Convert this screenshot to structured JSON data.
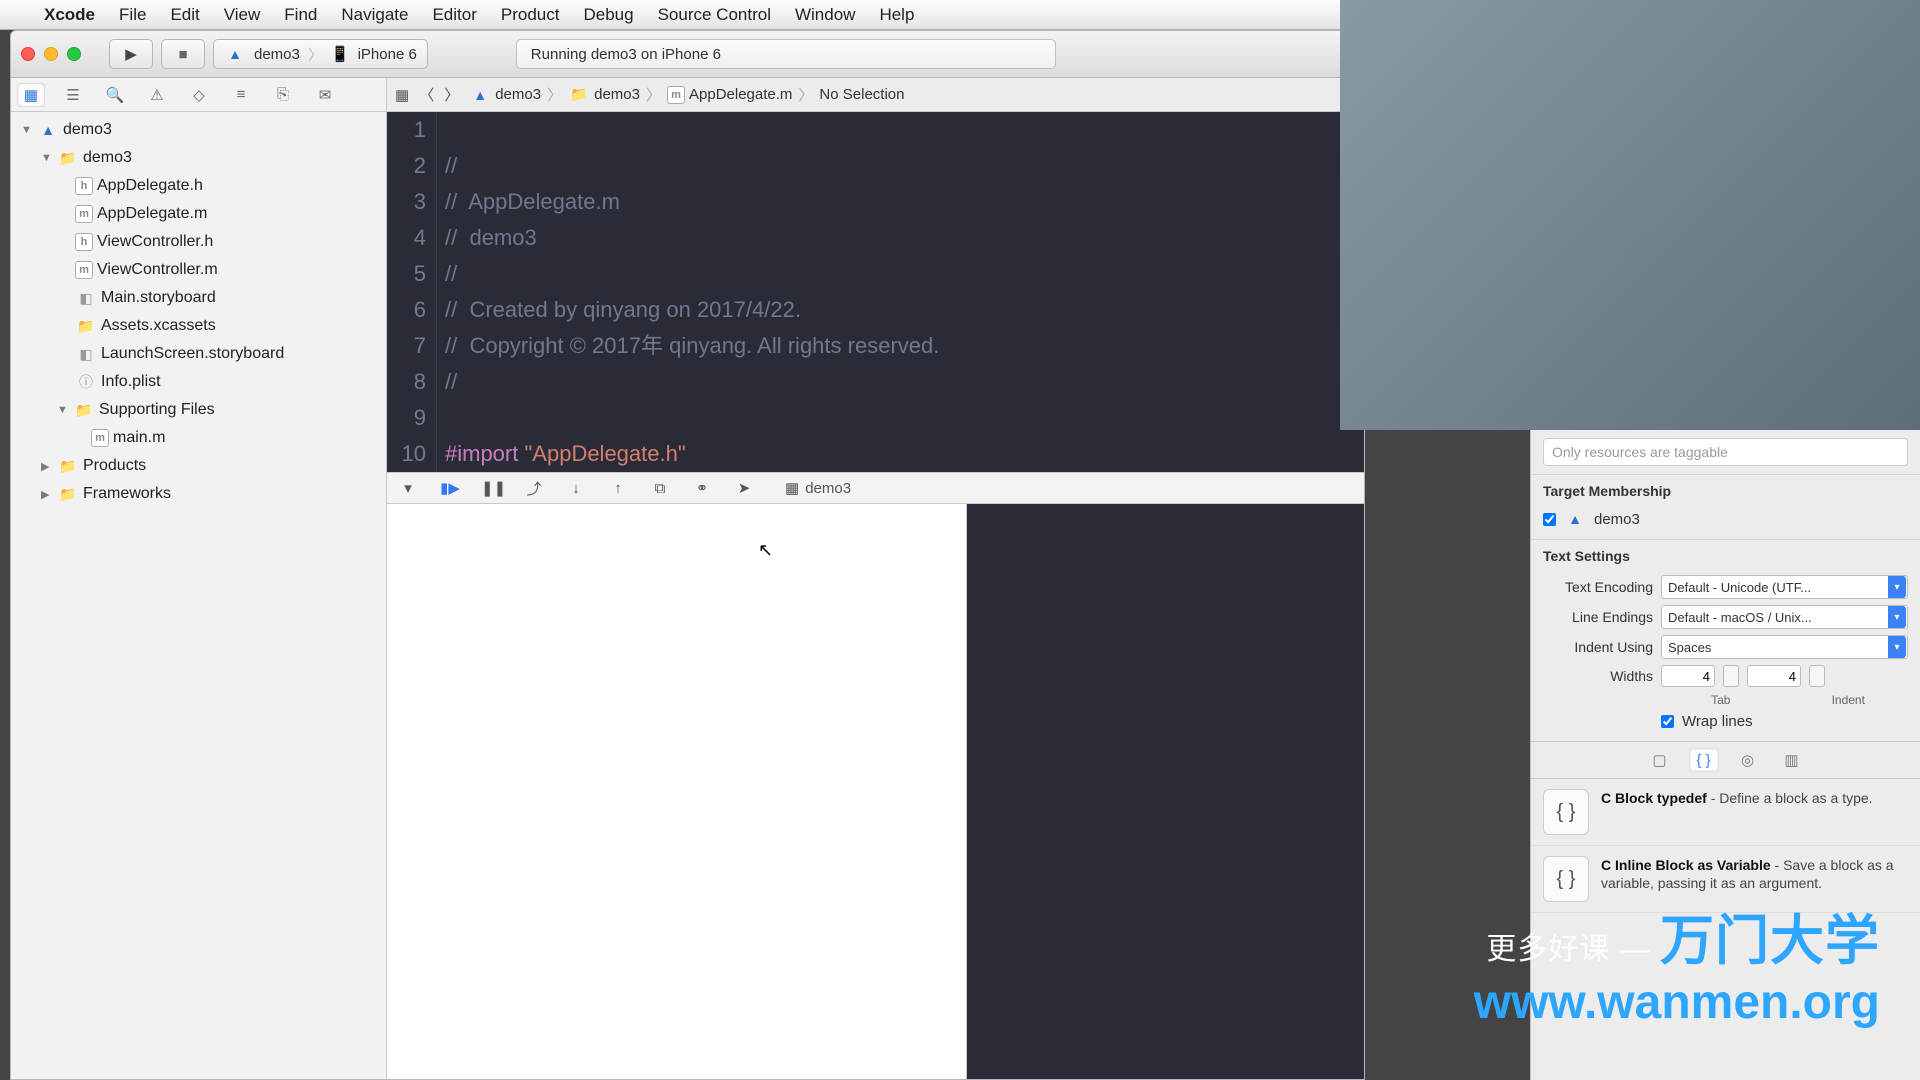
{
  "menubar": {
    "app": "Xcode",
    "items": [
      "File",
      "Edit",
      "View",
      "Find",
      "Navigate",
      "Editor",
      "Product",
      "Debug",
      "Source Control",
      "Window",
      "Help"
    ]
  },
  "toolbar": {
    "scheme_target": "demo3",
    "scheme_device": "iPhone 6",
    "status": "Running demo3 on iPhone 6"
  },
  "navigator": {
    "root": "demo3",
    "group": "demo3",
    "files": [
      "AppDelegate.h",
      "AppDelegate.m",
      "ViewController.h",
      "ViewController.m",
      "Main.storyboard",
      "Assets.xcassets",
      "LaunchScreen.storyboard",
      "Info.plist"
    ],
    "supporting": {
      "label": "Supporting Files",
      "items": [
        "main.m"
      ]
    },
    "products": "Products",
    "frameworks": "Frameworks"
  },
  "jumpbar": {
    "p1": "demo3",
    "p2": "demo3",
    "p3": "AppDelegate.m",
    "p4": "No Selection"
  },
  "code": {
    "lines": [
      {
        "n": "1",
        "cm": "//"
      },
      {
        "n": "2",
        "cm": "//  ",
        "t": "AppDelegate.m"
      },
      {
        "n": "3",
        "cm": "//  ",
        "t": "demo3"
      },
      {
        "n": "4",
        "cm": "//"
      },
      {
        "n": "5",
        "cm": "//  ",
        "t": "Created by qinyang on 2017/4/22."
      },
      {
        "n": "6",
        "cm": "//  ",
        "t": "Copyright © 2017年 qinyang. All rights reserved."
      },
      {
        "n": "7",
        "cm": "//"
      },
      {
        "n": "8",
        "cm": ""
      },
      {
        "n": "9",
        "kw": "#import ",
        "str": "\"AppDelegate.h\""
      },
      {
        "n": "10",
        "cm": ""
      }
    ]
  },
  "debugbar": {
    "target": "demo3"
  },
  "inspector": {
    "tag_placeholder": "Only resources are taggable",
    "target_membership": {
      "title": "Target Membership",
      "item": "demo3"
    },
    "text_settings": {
      "title": "Text Settings",
      "encoding_label": "Text Encoding",
      "encoding": "Default - Unicode (UTF...",
      "endings_label": "Line Endings",
      "endings": "Default - macOS / Unix...",
      "indent_label": "Indent Using",
      "indent": "Spaces",
      "widths_label": "Widths",
      "tab": "4",
      "indent_w": "4",
      "tab_caption": "Tab",
      "indent_caption": "Indent",
      "wrap": "Wrap lines"
    },
    "snippets": [
      {
        "title": "C Block typedef",
        "desc": " - Define a block as a type."
      },
      {
        "title": "C Inline Block as Variable",
        "desc": " - Save a block as a variable, passing it as an argument."
      }
    ]
  },
  "watermark": {
    "l1_pre": "更多好课 — ",
    "l1_big": "万门大学",
    "l2": "www.wanmen.org"
  }
}
